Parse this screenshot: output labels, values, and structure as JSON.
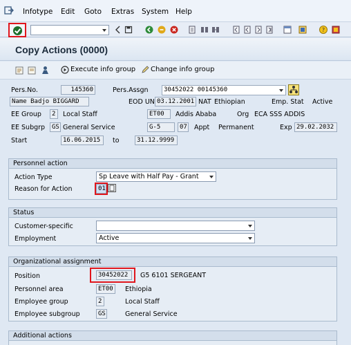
{
  "menu": {
    "items": [
      "Infotype",
      "Edit",
      "Goto",
      "Extras",
      "System",
      "Help"
    ]
  },
  "toolbar": {
    "command_value": ""
  },
  "title": "Copy Actions (0000)",
  "app_toolbar": {
    "execute_label": "Execute info group",
    "change_label": "Change info group"
  },
  "header": {
    "pers_no_label": "Pers.No.",
    "pers_no": "145360",
    "pers_assgn_label": "Pers.Assgn",
    "pers_assgn": "30452022 00145360",
    "name_label": "Name",
    "name": "Badjo BIGGARD",
    "eod_label": "EOD UN",
    "eod": "03.12.2001",
    "nat_label": "NAT",
    "nat": "Ethiopian",
    "emp_stat_label": "Emp. Stat",
    "emp_stat": "Active",
    "ee_group_label": "EE Group",
    "ee_group_code": "2",
    "ee_group_text": "Local Staff",
    "pa_code": "ET00",
    "pa_text": "Addis Ababa",
    "org_label": "Org",
    "org": "ECA SSS ADDIS",
    "ee_subgrp_label": "EE Subgrp",
    "ee_subgrp_code": "GS",
    "ee_subgrp_text": "General Service",
    "grade": "G-5",
    "step": "07",
    "appt_label": "Appt",
    "appt": "Permanent",
    "exp_label": "Exp",
    "exp": "29.02.2032",
    "start_label": "Start",
    "start": "16.06.2015",
    "to_label": "to",
    "end": "31.12.9999"
  },
  "personnel_action": {
    "title": "Personnel action",
    "action_type_label": "Action Type",
    "action_type": "Sp Leave with Half Pay - Grant",
    "reason_label": "Reason for Action",
    "reason": "01"
  },
  "status": {
    "title": "Status",
    "customer_label": "Customer-specific",
    "customer": "",
    "employment_label": "Employment",
    "employment": "Active"
  },
  "org_assignment": {
    "title": "Organizational assignment",
    "position_label": "Position",
    "position": "30452022",
    "position_text": "G5 6101 SERGEANT",
    "pers_area_label": "Personnel area",
    "pers_area": "ET00",
    "pers_area_text": "Ethiopia",
    "emp_group_label": "Employee group",
    "emp_group": "2",
    "emp_group_text": "Local Staff",
    "emp_subgroup_label": "Employee subgroup",
    "emp_subgroup": "GS",
    "emp_subgroup_text": "General Service"
  },
  "additional_actions": {
    "title": "Additional actions"
  },
  "colors": {
    "highlight": "#e0151c",
    "ok_green": "#1c6e2a"
  }
}
